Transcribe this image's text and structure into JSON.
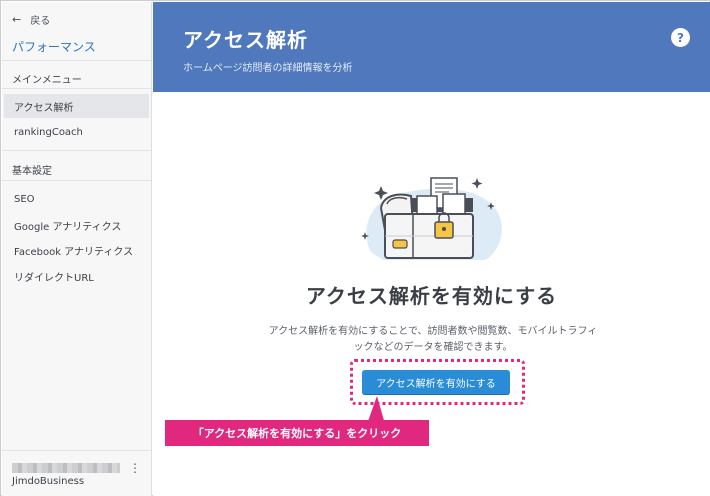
{
  "sidebar": {
    "back_label": "戻る",
    "section_title": "パフォーマンス",
    "main_menu_label": "メインメニュー",
    "main_items": [
      {
        "label": "アクセス解析",
        "active": true
      },
      {
        "label": "rankingCoach",
        "active": false
      }
    ],
    "basic_settings_label": "基本設定",
    "settings_items": [
      {
        "label": "SEO"
      },
      {
        "label": "Google アナリティクス"
      },
      {
        "label": "Facebook アナリティクス"
      },
      {
        "label": "リダイレクトURL"
      }
    ],
    "account": {
      "plan": "JimdoBusiness",
      "more_icon": "⋮"
    }
  },
  "header": {
    "title": "アクセス解析",
    "subtitle": "ホームページ訪問者の詳細情報を分析",
    "help_icon": "?"
  },
  "main": {
    "illustration_icon": "treasure-chest-icon",
    "heading": "アクセス解析を有効にする",
    "description": "アクセス解析を有効にすることで、訪問者数や閲覧数、モバイルトラフィックなどのデータを確認できます。",
    "cta_label": "アクセス解析を有効にする",
    "callout": "「アクセス解析を有効にする」をクリック"
  },
  "colors": {
    "header_bg": "#4f78bd",
    "cta_bg": "#2a8bd6",
    "callout_bg": "#e0287e",
    "section_title": "#2f73b8"
  }
}
